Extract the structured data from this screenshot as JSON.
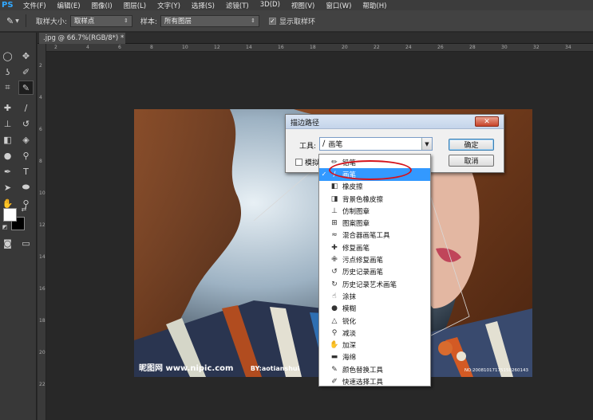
{
  "app": {
    "logo": "PS"
  },
  "menus": [
    "文件(F)",
    "编辑(E)",
    "图像(I)",
    "图层(L)",
    "文字(Y)",
    "选择(S)",
    "滤镜(T)",
    "3D(D)",
    "视图(V)",
    "窗口(W)",
    "帮助(H)"
  ],
  "options": {
    "sample_size_label": "取样大小:",
    "sample_size_value": "取样点",
    "sample_label": "样本:",
    "sample_value": "所有图层",
    "show_ring_label": "显示取样环",
    "show_ring_checked": true
  },
  "document": {
    "tab_title": ".jpg @ 66.7%(RGB/8*) *"
  },
  "ruler": {
    "h": [
      "2",
      "4",
      "6",
      "8",
      "10",
      "12",
      "14",
      "16",
      "18",
      "20",
      "22",
      "24",
      "26",
      "28",
      "30",
      "32",
      "34"
    ],
    "v": [
      "2",
      "4",
      "6",
      "8",
      "10",
      "12",
      "14",
      "16",
      "18",
      "20",
      "22"
    ]
  },
  "photo": {
    "watermark_left": "昵图网 www.nipic.com",
    "watermark_by": "BY:aotianshui",
    "watermark_right": "NO:20081017175150260143"
  },
  "dialog": {
    "title": "描边路径",
    "close_symbol": "✕",
    "tool_label": "工具:",
    "tool_value": "画笔",
    "simulate_label": "模拟",
    "ok_label": "确定",
    "cancel_label": "取消"
  },
  "dropdown": {
    "selected_index": 1,
    "items": [
      {
        "label": "铅笔",
        "icon": "pencil-icon"
      },
      {
        "label": "画笔",
        "icon": "brush-icon"
      },
      {
        "label": "橡皮擦",
        "icon": "eraser-icon"
      },
      {
        "label": "背景色橡皮擦",
        "icon": "bg-eraser-icon"
      },
      {
        "label": "仿制图章",
        "icon": "clone-stamp-icon"
      },
      {
        "label": "图案图章",
        "icon": "pattern-stamp-icon"
      },
      {
        "label": "混合器画笔工具",
        "icon": "mixer-brush-icon"
      },
      {
        "label": "修复画笔",
        "icon": "healing-brush-icon"
      },
      {
        "label": "污点修复画笔",
        "icon": "spot-healing-icon"
      },
      {
        "label": "历史记录画笔",
        "icon": "history-brush-icon"
      },
      {
        "label": "历史记录艺术画笔",
        "icon": "art-history-brush-icon"
      },
      {
        "label": "涂抹",
        "icon": "smudge-icon"
      },
      {
        "label": "模糊",
        "icon": "blur-icon"
      },
      {
        "label": "锐化",
        "icon": "sharpen-icon"
      },
      {
        "label": "减淡",
        "icon": "dodge-icon"
      },
      {
        "label": "加深",
        "icon": "burn-icon"
      },
      {
        "label": "海绵",
        "icon": "sponge-icon"
      },
      {
        "label": "颜色替换工具",
        "icon": "color-replace-icon"
      },
      {
        "label": "快速选择工具",
        "icon": "quick-select-icon"
      }
    ]
  },
  "colors": {
    "annotation": "#d4131c",
    "selection": "#3399ff",
    "foreground": "#ffffff",
    "background": "#000000"
  }
}
